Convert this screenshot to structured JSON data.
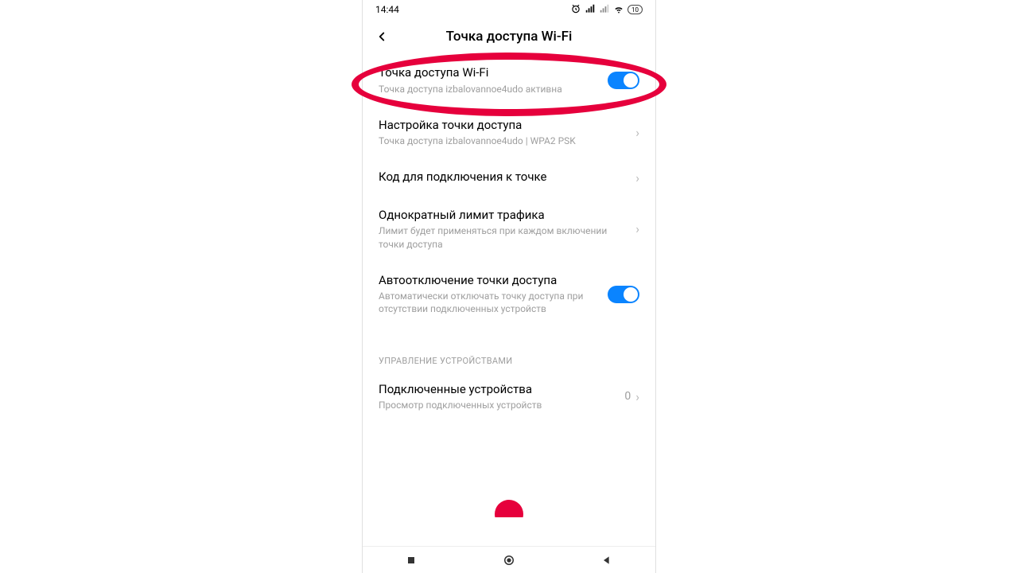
{
  "statusbar": {
    "time": "14:44",
    "battery": "10"
  },
  "header": {
    "title": "Точка доступа Wi-Fi"
  },
  "row_hotspot": {
    "title": "Точка доступа Wi-Fi",
    "sub": "Точка доступа izbalovannoe4udo активна"
  },
  "row_setup": {
    "title": "Настройка точки доступа",
    "sub": "Точка доступа izbalovannoe4udo | WPA2 PSK"
  },
  "row_code": {
    "title": "Код для подключения к точке"
  },
  "row_limit": {
    "title": "Однократный лимит трафика",
    "sub": "Лимит будет применяться при каждом включении точки доступа"
  },
  "row_auto": {
    "title": "Автоотключение точки доступа",
    "sub": "Автоматически отключать точку доступа при отсутствии подключенных устройств"
  },
  "section_devices": "УПРАВЛЕНИЕ УСТРОЙСТВАМИ",
  "row_connected": {
    "title": "Подключенные устройства",
    "sub": "Просмотр подключенных устройств",
    "count": "0"
  }
}
